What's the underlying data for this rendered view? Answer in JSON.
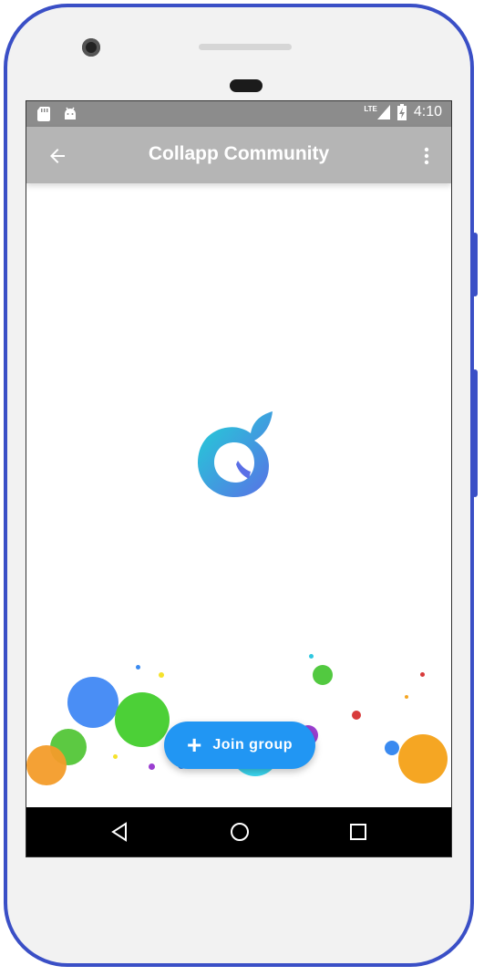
{
  "status_bar": {
    "network": "LTE",
    "time": "4:10"
  },
  "app_bar": {
    "title": "Collapp Community"
  },
  "fab": {
    "label": "Join group",
    "icon": "plus-icon"
  },
  "icons": {
    "back": "arrow-left-icon",
    "more": "more-vert-icon",
    "nav_back": "nav-back-icon",
    "nav_home": "nav-home-icon",
    "nav_recents": "nav-recents-icon"
  },
  "colors": {
    "status_bar": "#8c8c8c",
    "app_bar": "#b5b5b5",
    "fab": "#2196f3",
    "frame": "#3a4fc6"
  }
}
